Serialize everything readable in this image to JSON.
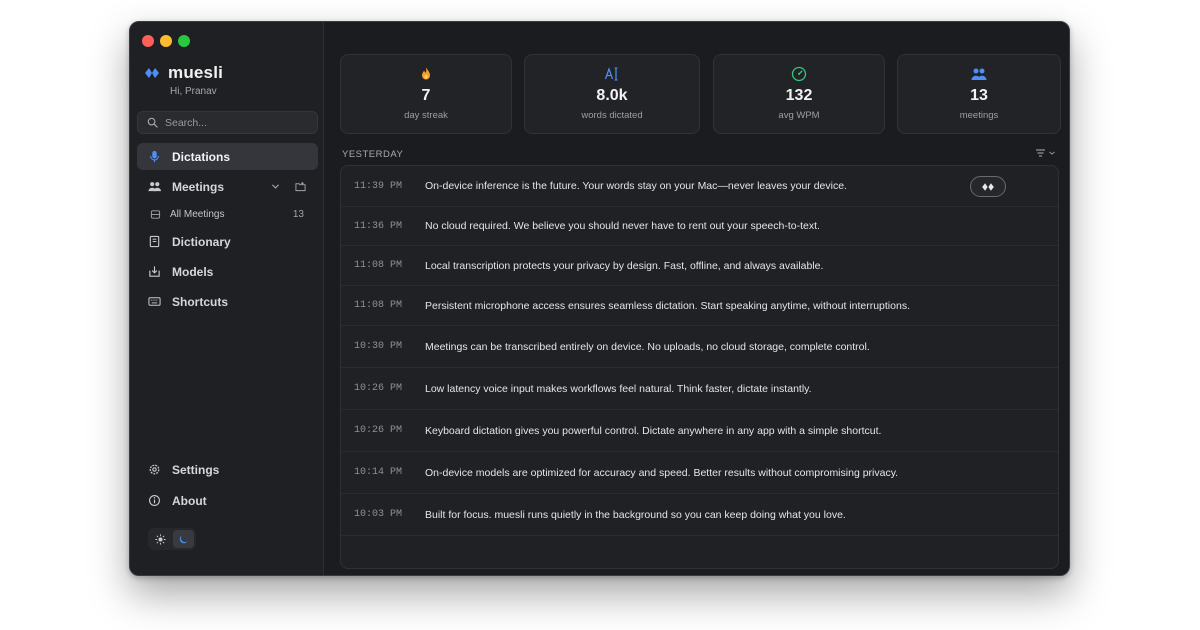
{
  "app": {
    "name": "muesli",
    "greeting": "Hi, Pranav"
  },
  "search": {
    "placeholder": "Search..."
  },
  "sidebar": {
    "nav": [
      {
        "label": "Dictations",
        "icon": "microphone-icon",
        "active": true
      },
      {
        "label": "Meetings",
        "icon": "people-icon",
        "active": false
      },
      {
        "label": "Dictionary",
        "icon": "book-icon",
        "active": false
      },
      {
        "label": "Models",
        "icon": "download-box-icon",
        "active": false
      },
      {
        "label": "Shortcuts",
        "icon": "keyboard-icon",
        "active": false
      }
    ],
    "all_meetings": {
      "label": "All Meetings",
      "count": "13"
    },
    "bottom": [
      {
        "label": "Settings",
        "icon": "gear-icon"
      },
      {
        "label": "About",
        "icon": "info-icon"
      }
    ],
    "theme": {
      "selected": "dark"
    }
  },
  "stats": [
    {
      "value": "7",
      "label": "day streak",
      "icon": "flame-icon",
      "color": "#f59e2b"
    },
    {
      "value": "8.0k",
      "label": "words dictated",
      "icon": "text-cursor-icon",
      "color": "#4f8ef7"
    },
    {
      "value": "132",
      "label": "avg WPM",
      "icon": "speedometer-icon",
      "color": "#34c77b"
    },
    {
      "value": "13",
      "label": "meetings",
      "icon": "people-icon",
      "color": "#4f8ef7"
    }
  ],
  "section": {
    "label": "YESTERDAY"
  },
  "dictations": [
    {
      "time": "11:39 PM",
      "text": "On-device inference is the future. Your words stay on your Mac—never leaves your device."
    },
    {
      "time": "11:36 PM",
      "text": "No cloud required. We believe you should never have to rent out your speech-to-text."
    },
    {
      "time": "11:08 PM",
      "text": "Local transcription protects your privacy by design. Fast, offline, and always available."
    },
    {
      "time": "11:08 PM",
      "text": "Persistent microphone access ensures seamless dictation. Start speaking anytime, without interruptions."
    },
    {
      "time": "10:30 PM",
      "text": "Meetings can be transcribed entirely on device. No uploads, no cloud storage, complete control."
    },
    {
      "time": "10:26 PM",
      "text": "Low latency voice input makes workflows feel natural. Think faster, dictate instantly."
    },
    {
      "time": "10:26 PM",
      "text": "Keyboard dictation gives you powerful control. Dictate anywhere in any app with a simple shortcut."
    },
    {
      "time": "10:14 PM",
      "text": "On-device models are optimized for accuracy and speed. Better results without compromising privacy."
    },
    {
      "time": "10:03 PM",
      "text": "Built for focus. muesli runs quietly in the background so you can keep doing what you love."
    }
  ],
  "colors": {
    "accent": "#4f8ef7",
    "window_bg": "#1b1c1f",
    "sidebar_bg": "#1f2023",
    "active_item_bg": "#34363c"
  }
}
